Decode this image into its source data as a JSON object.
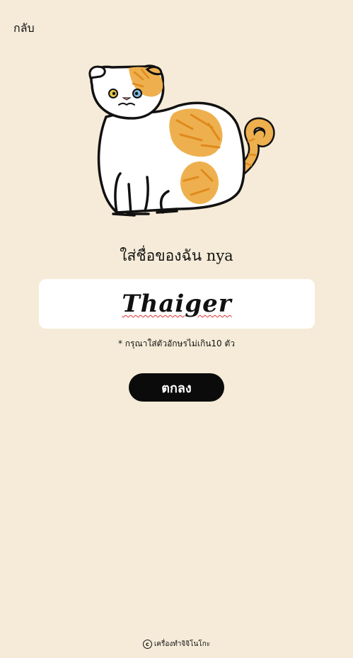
{
  "nav": {
    "back_label": "กลับ"
  },
  "prompt": "ใส่ชื่อของฉัน nya",
  "name_input": {
    "value": "Thaiger"
  },
  "hint": "* กรุณาใส่ตัวอักษรไม่เกิน10 ตัว",
  "confirm_label": "ตกลง",
  "footer": {
    "icon": "copyright-icon",
    "text": "เครื่องทำจิจิโนโกะ"
  },
  "colors": {
    "background": "#f5ebd8",
    "button": "#0b0b0b",
    "cat_orange": "#eeb04e",
    "cat_stripe": "#e08a1c"
  }
}
